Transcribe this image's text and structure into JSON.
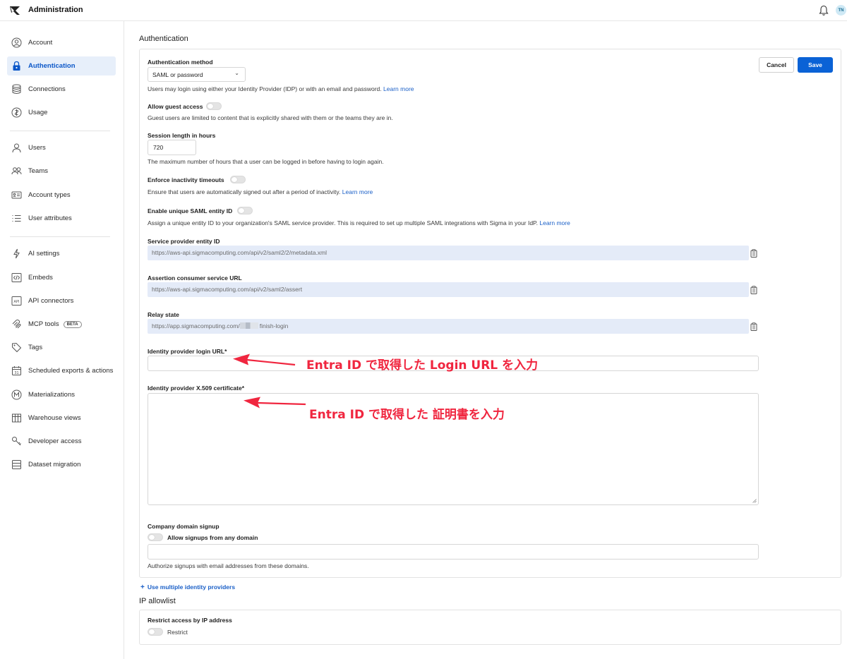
{
  "app": {
    "title": "Administration",
    "avatar_initials": "TN"
  },
  "sidebar": {
    "items": [
      {
        "label": "Account",
        "icon": "account-icon"
      },
      {
        "label": "Authentication",
        "icon": "lock-icon",
        "active": true
      },
      {
        "label": "Connections",
        "icon": "database-icon"
      },
      {
        "label": "Usage",
        "icon": "usage-icon"
      },
      {
        "label": "Users",
        "icon": "user-icon"
      },
      {
        "label": "Teams",
        "icon": "teams-icon"
      },
      {
        "label": "Account types",
        "icon": "id-card-icon"
      },
      {
        "label": "User attributes",
        "icon": "list-icon"
      },
      {
        "label": "AI settings",
        "icon": "lightning-icon"
      },
      {
        "label": "Embeds",
        "icon": "code-icon"
      },
      {
        "label": "API connectors",
        "icon": "api-icon"
      },
      {
        "label": "MCP tools",
        "icon": "mcp-icon",
        "badge": "BETA"
      },
      {
        "label": "Tags",
        "icon": "tag-icon"
      },
      {
        "label": "Scheduled exports & actions",
        "icon": "calendar-icon"
      },
      {
        "label": "Materializations",
        "icon": "materialization-icon"
      },
      {
        "label": "Warehouse views",
        "icon": "table-icon"
      },
      {
        "label": "Developer access",
        "icon": "key-icon"
      },
      {
        "label": "Dataset migration",
        "icon": "stack-icon"
      }
    ]
  },
  "authentication": {
    "section_title": "Authentication",
    "cancel_label": "Cancel",
    "save_label": "Save",
    "method": {
      "label": "Authentication method",
      "value": "SAML or password",
      "help": "Users may login using either your Identity Provider (IDP) or with an email and password.",
      "link": "Learn more"
    },
    "guest": {
      "label": "Allow guest access",
      "help": "Guest users are limited to content that is explicitly shared with them or the teams they are in."
    },
    "session": {
      "label": "Session length in hours",
      "value": "720",
      "help": "The maximum number of hours that a user can be logged in before having to login again."
    },
    "inactivity": {
      "label": "Enforce inactivity timeouts",
      "help": "Ensure that users are automatically signed out after a period of inactivity.",
      "link": "Learn more"
    },
    "unique_saml": {
      "label": "Enable unique SAML entity ID",
      "help": "Assign a unique entity ID to your organization's SAML service provider. This is required to set up multiple SAML integrations with Sigma in your IdP.",
      "link": "Learn more"
    },
    "sp_entity": {
      "label": "Service provider entity ID",
      "value": "https://aws-api.sigmacomputing.com/api/v2/saml2/2/metadata.xml"
    },
    "acs_url": {
      "label": "Assertion consumer service URL",
      "value": "https://aws-api.sigmacomputing.com/api/v2/saml2/assert"
    },
    "relay": {
      "label": "Relay state",
      "value_prefix": "https://app.sigmacomputing.com/",
      "value_suffix": "finish-login"
    },
    "idp_login": {
      "label": "Identity provider login URL*",
      "value": ""
    },
    "idp_cert": {
      "label": "Identity provider X.509 certificate*",
      "value": ""
    },
    "domain_signup": {
      "label": "Company domain signup",
      "toggle_label": "Allow signups from any domain",
      "value": "",
      "help": "Authorize signups with email addresses from these domains."
    },
    "multiple_idp_link": "Use multiple identity providers"
  },
  "ip_allowlist": {
    "section_title": "IP allowlist",
    "label": "Restrict access by IP address",
    "toggle_label": "Restrict"
  },
  "annotations": {
    "login_url": "Entra ID で取得した Login URL を入力",
    "certificate": "Entra ID で取得した 証明書を入力"
  },
  "colors": {
    "accent": "#0a62d6",
    "active_bg": "#e7effa",
    "annotation": "#f0263f",
    "readonly_bg": "#e4ebf8"
  }
}
